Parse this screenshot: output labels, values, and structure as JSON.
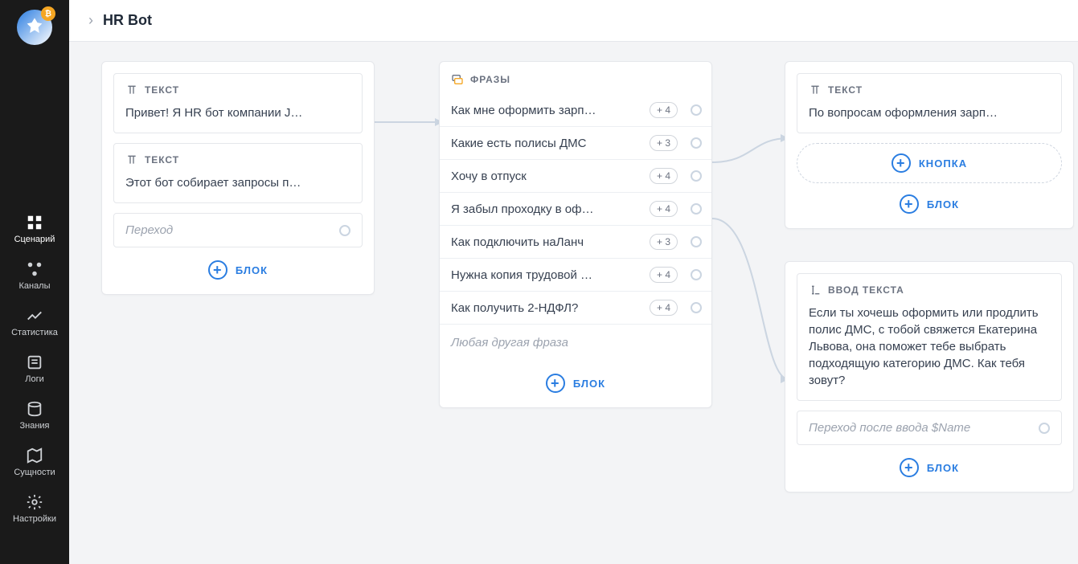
{
  "logo_badge": "₿",
  "header": {
    "title": "HR Bot"
  },
  "sidebar": {
    "items": [
      {
        "label": "Сценарий"
      },
      {
        "label": "Каналы"
      },
      {
        "label": "Статистика"
      },
      {
        "label": "Логи"
      },
      {
        "label": "Знания"
      },
      {
        "label": "Сущности"
      },
      {
        "label": "Настройки"
      }
    ]
  },
  "buttons": {
    "block": "БЛОК",
    "button": "КНОПКА"
  },
  "node1": {
    "sections": [
      {
        "label": "ТЕКСТ",
        "body": "Привет! Я HR бот компании J…"
      },
      {
        "label": "ТЕКСТ",
        "body": "Этот бот собирает запросы п…"
      }
    ],
    "transition": "Переход"
  },
  "node2": {
    "label": "ФРАЗЫ",
    "phrases": [
      {
        "text": "Как мне оформить зарп…",
        "badge": "+ 4"
      },
      {
        "text": "Какие есть полисы ДМС",
        "badge": "+ 3"
      },
      {
        "text": "Хочу в отпуск",
        "badge": "+ 4"
      },
      {
        "text": "Я забыл проходку в оф…",
        "badge": "+ 4"
      },
      {
        "text": "Как подключить наЛанч",
        "badge": "+ 3"
      },
      {
        "text": "Нужна копия трудовой …",
        "badge": "+ 4"
      },
      {
        "text": "Как получить 2-НДФЛ?",
        "badge": "+ 4"
      }
    ],
    "other": "Любая другая фраза"
  },
  "node3": {
    "label": "ТЕКСТ",
    "body": "По вопросам оформления зарп…"
  },
  "node4": {
    "label": "ВВОД ТЕКСТА",
    "body": "Если ты хочешь оформить или продлить полис ДМС, с тобой свяжется Екатерина Львова, она поможет тебе выбрать подходящую категорию ДМС. Как тебя зовут?",
    "transition": "Переход после ввода $Name"
  }
}
